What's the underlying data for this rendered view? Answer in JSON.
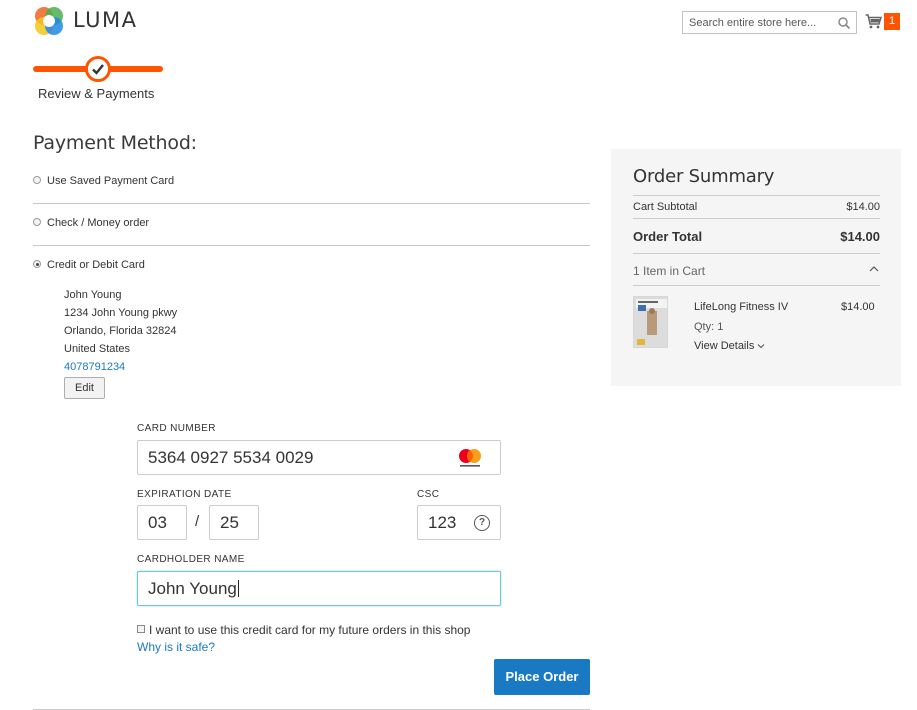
{
  "header": {
    "logo_text": "LUMA",
    "search_placeholder": "Search entire store here...",
    "cart_count": "1",
    "brand_accent": "#ff5501"
  },
  "progress": {
    "step_label": "Review & Payments"
  },
  "payment": {
    "title": "Payment Method:",
    "methods": [
      {
        "label": "Use Saved Payment Card",
        "selected": false
      },
      {
        "label": "Check / Money order",
        "selected": false
      },
      {
        "label": "Credit or Debit Card",
        "selected": true
      }
    ],
    "address": {
      "name": "John Young",
      "street": "1234 John Young pkwy",
      "city_line": "Orlando, Florida 32824",
      "country": "United States",
      "phone": "4078791234",
      "edit_label": "Edit"
    },
    "card": {
      "number_label": "CARD NUMBER",
      "number_value": "5364 0927 5534 0029",
      "card_brand_icon": "mastercard-icon",
      "expiration_label": "EXPIRATION DATE",
      "exp_month": "03",
      "exp_separator": "/",
      "exp_year": "25",
      "csc_label": "CSC",
      "csc_value": "123",
      "help_glyph": "?",
      "holder_label": "CARDHOLDER NAME",
      "holder_value": "John Young"
    },
    "save_card_label": "I want to use this credit card for my future orders in this shop",
    "why_safe_link": "Why is it safe?",
    "place_order_label": "Place Order",
    "button_color": "#1979c3"
  },
  "summary": {
    "title": "Order Summary",
    "subtotal_label": "Cart Subtotal",
    "subtotal_value": "$14.00",
    "total_label": "Order Total",
    "total_value": "$14.00",
    "items_in_cart": "1 Item in Cart",
    "product": {
      "name": "LifeLong Fitness IV",
      "price": "$14.00",
      "qty": "Qty: 1",
      "view_details": "View Details"
    }
  }
}
